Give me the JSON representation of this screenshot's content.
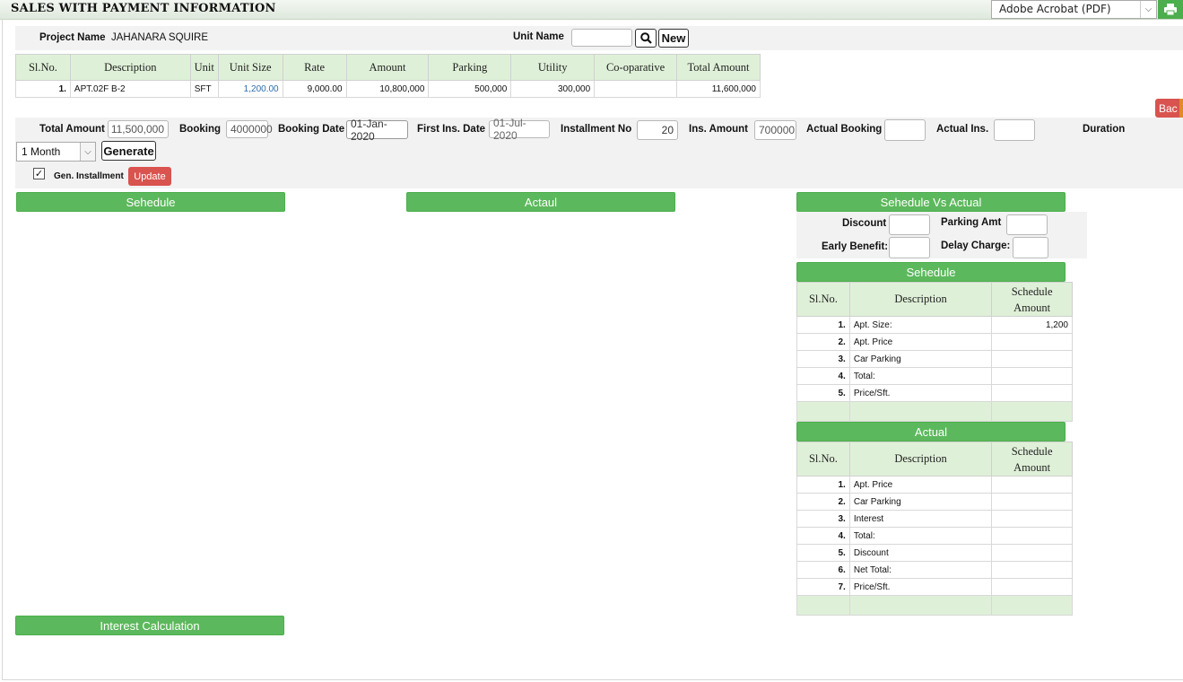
{
  "header": {
    "title": "SALES WITH PAYMENT INFORMATION",
    "format_select": "Adobe Acrobat (PDF)",
    "print_icon": "printer-icon"
  },
  "project": {
    "project_name_label": "Project Name",
    "project_name_value": "JAHANARA SQUIRE",
    "unit_name_label": "Unit Name",
    "unit_name_value": "",
    "new_label": "New",
    "search_icon": "search-icon"
  },
  "unit_table": {
    "headers": [
      "Sl.No.",
      "Description",
      "Unit",
      "Unit Size",
      "Rate",
      "Amount",
      "Parking",
      "Utility",
      "Co-oparative",
      "Total Amount"
    ],
    "rows": [
      [
        "1.",
        "APT.02F B-2",
        "SFT",
        "1,200.00",
        "9,000.00",
        "10,800,000",
        "500,000",
        "300,000",
        "",
        "11,600,000"
      ]
    ]
  },
  "back_label": "Bac",
  "installment": {
    "total_amount_label": "Total Amount",
    "total_amount_value": "11,500,000",
    "booking_label": "Booking",
    "booking_value": "4000000",
    "booking_date_label": "Booking Date",
    "booking_date_value": "01-Jan-2020",
    "first_ins_date_label": "First Ins. Date",
    "first_ins_date_value": "01-Jul-2020",
    "installment_no_label": "Installment No",
    "installment_no_value": "20",
    "ins_amount_label": "Ins. Amount",
    "ins_amount_value": "700000",
    "actual_booking_label": "Actual Booking",
    "actual_booking_value": "",
    "actual_ins_label": "Actual Ins.",
    "actual_ins_value": "",
    "duration_label": "Duration",
    "duration_value": "1 Month",
    "generate_label": "Generate",
    "gen_installment_label": "Gen. Installment",
    "update_label": "Update"
  },
  "sections": {
    "schedule": "Sehedule",
    "actual": "Actaul",
    "schedule_vs_actual": "Sehedule Vs Actual",
    "interest_calc": "Interest Calculation"
  },
  "sva": {
    "discount_label": "Discount",
    "parking_amt_label": "Parking Amt",
    "early_benefit_label": "Early Benefit:",
    "delay_charge_label": "Delay Charge:"
  },
  "schedule_table": {
    "title": "Sehedule",
    "headers": [
      "Sl.No.",
      "Description",
      "Schedule Amount"
    ],
    "rows": [
      [
        "1.",
        "Apt. Size:",
        "1,200"
      ],
      [
        "2.",
        "Apt. Price",
        ""
      ],
      [
        "3.",
        "Car Parking",
        ""
      ],
      [
        "4.",
        "Total:",
        ""
      ],
      [
        "5.",
        "Price/Sft.",
        ""
      ]
    ]
  },
  "actual_table": {
    "title": "Actual",
    "headers": [
      "Sl.No.",
      "Description",
      "Schedule Amount"
    ],
    "rows": [
      [
        "1.",
        "Apt. Price",
        ""
      ],
      [
        "2.",
        "Car Parking",
        ""
      ],
      [
        "3.",
        "Interest",
        ""
      ],
      [
        "4.",
        "Total:",
        ""
      ],
      [
        "5.",
        "Discount",
        ""
      ],
      [
        "6.",
        "Net Total:",
        ""
      ],
      [
        "7.",
        "Price/Sft.",
        ""
      ]
    ]
  }
}
